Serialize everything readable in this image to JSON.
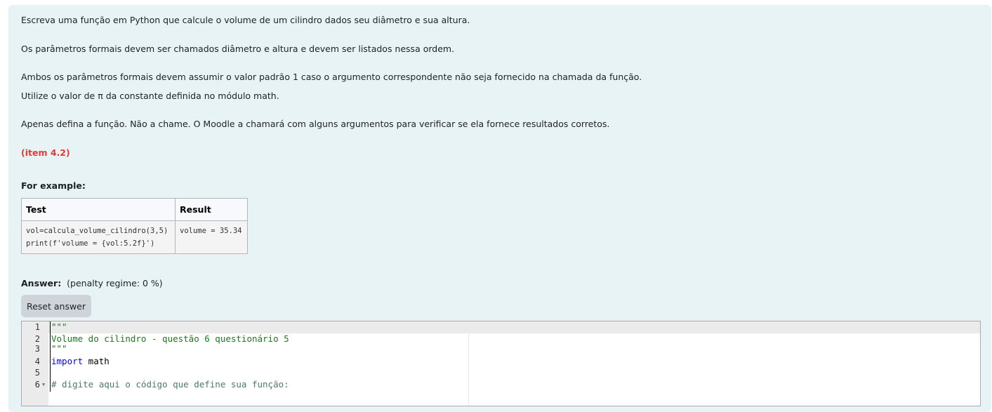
{
  "question": {
    "paragraphs": [
      "Escreva uma função em Python que calcule o volume de um cilindro dados seu diâmetro e sua altura.",
      "Os parâmetros formais devem ser chamados diâmetro e altura e devem ser listados nessa ordem.",
      "Ambos os parâmetros formais devem assumir o valor padrão 1 caso o argumento correspondente não seja fornecido na chamada da função.",
      "Utilize o valor de π da constante definida no módulo math.",
      "Apenas defina a função. Não a chame. O Moodle a chamará com alguns argumentos para verificar se ela fornece resultados corretos."
    ],
    "item_tag": "(item 4.2)",
    "for_example": "For example:",
    "table": {
      "headers": [
        "Test",
        "Result"
      ],
      "rows": [
        {
          "test": "vol=calcula_volume_cilindro(3,5)\nprint(f'volume = {vol:5.2f}')",
          "result": "volume = 35.34"
        }
      ]
    }
  },
  "answer": {
    "label": "Answer:",
    "penalty": "(penalty regime: 0 %)",
    "reset_label": "Reset answer"
  },
  "editor": {
    "lines": [
      {
        "n": "1",
        "text": "\"\"\""
      },
      {
        "n": "2",
        "text": "Volume do cilindro - questão 6 questionário 5"
      },
      {
        "n": "3",
        "text": "\"\"\""
      },
      {
        "n": "4",
        "kw": "import",
        "text": " math"
      },
      {
        "n": "5",
        "text": ""
      },
      {
        "n": "6",
        "text": "# digite aqui o código que define sua função:"
      }
    ]
  },
  "colors": {
    "item_tag": "#e53935",
    "panel_bg": "#e7f3f5",
    "string": "#1a7a1a",
    "keyword": "#0000ff"
  }
}
